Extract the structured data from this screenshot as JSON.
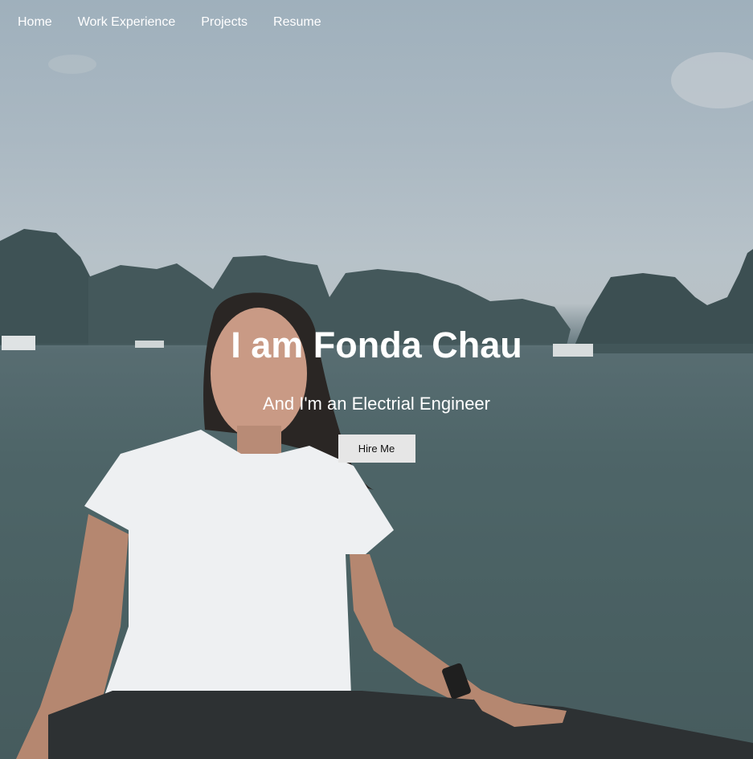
{
  "nav": {
    "items": [
      {
        "label": "Home"
      },
      {
        "label": "Work Experience"
      },
      {
        "label": "Projects"
      },
      {
        "label": "Resume"
      }
    ]
  },
  "hero": {
    "title": "I am Fonda Chau",
    "subtitle": "And I'm an Electrial Engineer",
    "cta_label": "Hire Me"
  },
  "colors": {
    "sky": "#a9b7c1",
    "water": "#4b6264",
    "mountains": "#3e5255",
    "button_bg": "#e6e6e6"
  }
}
